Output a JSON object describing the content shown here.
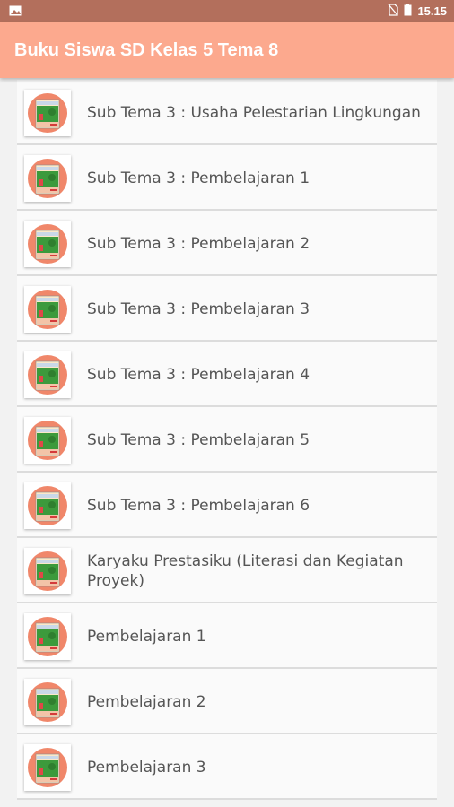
{
  "status": {
    "time": "15.15"
  },
  "app": {
    "title": "Buku Siswa SD Kelas 5 Tema 8"
  },
  "items": [
    {
      "label": "Sub Tema 3 : Usaha Pelestarian Lingkungan"
    },
    {
      "label": "Sub Tema 3 : Pembelajaran 1"
    },
    {
      "label": "Sub Tema 3 : Pembelajaran 2"
    },
    {
      "label": "Sub Tema 3 : Pembelajaran 3"
    },
    {
      "label": "Sub Tema 3 : Pembelajaran 4"
    },
    {
      "label": "Sub Tema 3 : Pembelajaran 5"
    },
    {
      "label": "Sub Tema 3 : Pembelajaran 6"
    },
    {
      "label": "Karyaku Prestasiku (Literasi dan Kegiatan Proyek)"
    },
    {
      "label": "Pembelajaran 1"
    },
    {
      "label": "Pembelajaran 2"
    },
    {
      "label": "Pembelajaran 3"
    }
  ],
  "colors": {
    "status_bar": "#b36f5c",
    "app_bar": "#fca98e",
    "icon_circle": "#f0876a",
    "book_green": "#3c9a3c"
  }
}
